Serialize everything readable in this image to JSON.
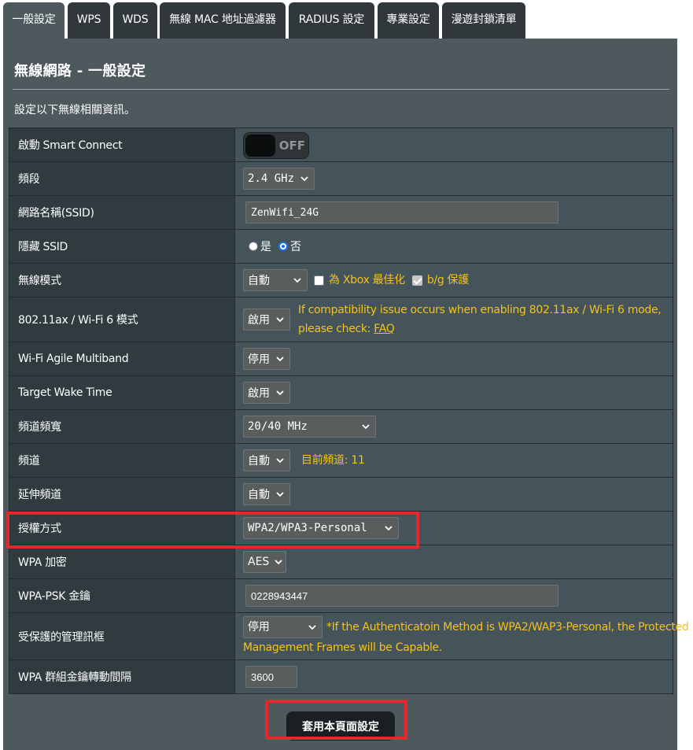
{
  "tabs": [
    {
      "label": "一般設定",
      "active": true
    },
    {
      "label": "WPS"
    },
    {
      "label": "WDS"
    },
    {
      "label": "無線 MAC 地址過濾器"
    },
    {
      "label": "RADIUS 設定"
    },
    {
      "label": "專業設定"
    },
    {
      "label": "漫遊封鎖清單"
    }
  ],
  "page": {
    "title": "無線網路 - 一般設定",
    "description": "設定以下無線相關資訊。"
  },
  "rows": {
    "smart_connect": {
      "label": "啟動 Smart Connect",
      "toggle": "OFF"
    },
    "band": {
      "label": "頻段",
      "value": "2.4 GHz"
    },
    "ssid": {
      "label": "網路名稱(SSID)",
      "value": "ZenWifi_24G"
    },
    "hide_ssid": {
      "label": "隱藏 SSID",
      "yes": "是",
      "no": "否",
      "selected": "no"
    },
    "wireless_mode": {
      "label": "無線模式",
      "value": "自動",
      "xbox_label": "為 Xbox 最佳化",
      "xbox_checked": false,
      "bg_label": "b/g 保護",
      "bg_checked": true
    },
    "ax_mode": {
      "label": "802.11ax / Wi-Fi 6 模式",
      "value": "啟用",
      "hint": "If compatibility issue occurs when enabling 802.11ax / Wi-Fi 6 mode,",
      "hint2": "please check: ",
      "faq": "FAQ"
    },
    "agile_multiband": {
      "label": "Wi-Fi Agile Multiband",
      "value": "停用"
    },
    "twt": {
      "label": "Target Wake Time",
      "value": "啟用"
    },
    "bandwidth": {
      "label": "頻道頻寬",
      "value": "20/40 MHz"
    },
    "channel": {
      "label": "頻道",
      "value": "自動",
      "current": "目前頻道: 11"
    },
    "ext_channel": {
      "label": "延伸頻道",
      "value": "自動"
    },
    "auth": {
      "label": "授權方式",
      "value": "WPA2/WPA3-Personal"
    },
    "encryption": {
      "label": "WPA 加密",
      "value": "AES"
    },
    "psk": {
      "label": "WPA-PSK 金鑰",
      "value": "0228943447"
    },
    "pmf": {
      "label": "受保護的管理訊框",
      "value": "停用",
      "hint": "*If the Authenticatoin Method is WPA2/WAP3-Personal, the Protected",
      "hint2": "Management Frames will be Capable."
    },
    "rekey": {
      "label": "WPA 群組金鑰轉動間隔",
      "value": "3600"
    }
  },
  "apply_button": "套用本頁面設定",
  "colors": {
    "highlight": "#e8272c",
    "hint": "#f4c21b",
    "panel": "#4d595d"
  }
}
